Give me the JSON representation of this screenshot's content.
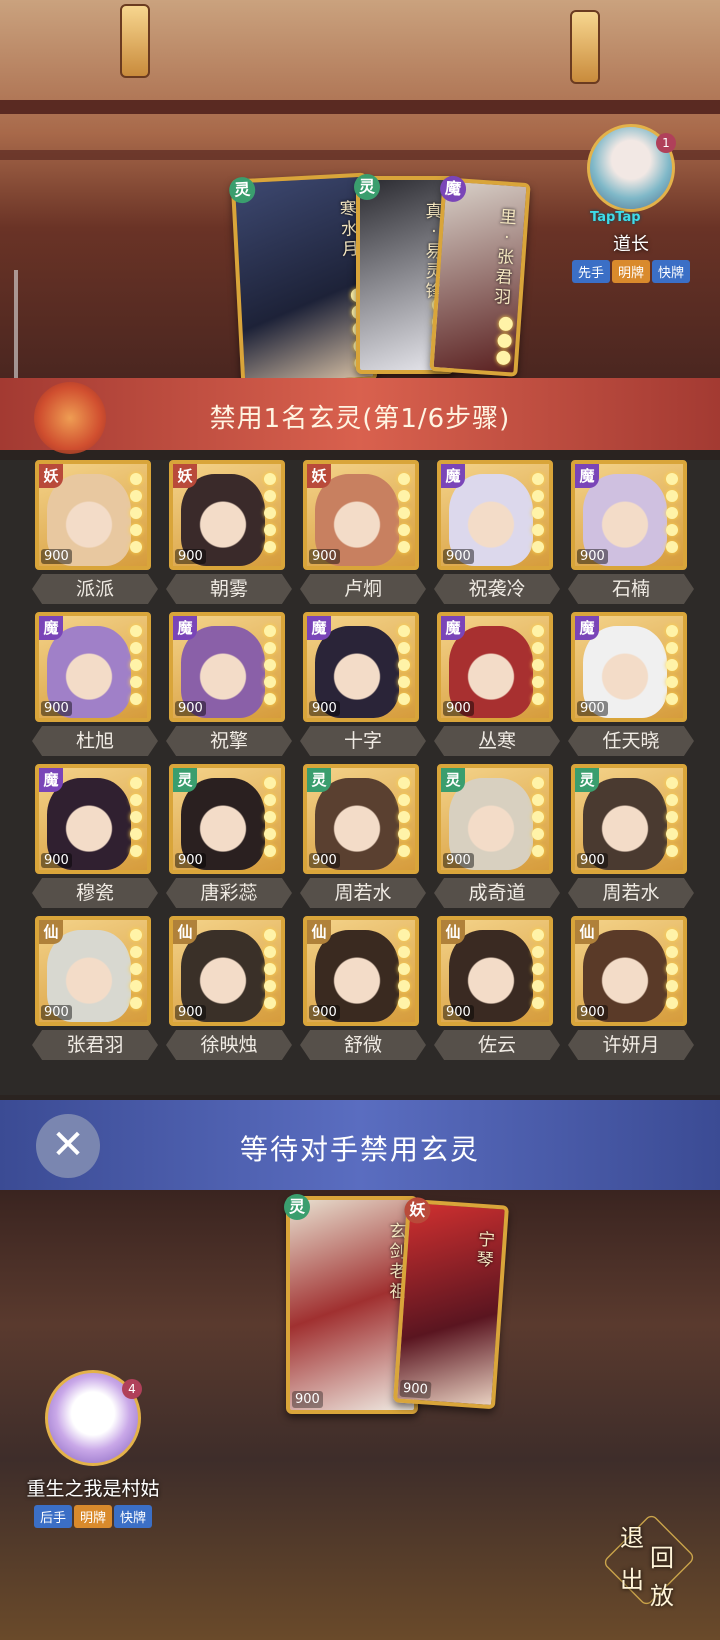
{
  "opponent": {
    "name": "道长",
    "level": "1",
    "platform": "TapTap",
    "tags": [
      "先手",
      "明牌",
      "快牌"
    ],
    "cards": [
      {
        "faction": "灵",
        "name": "寒水月"
      },
      {
        "faction": "灵",
        "name": "真·易灵锋"
      },
      {
        "faction": "魔",
        "name": "里·张君羽"
      }
    ]
  },
  "step_banner": "禁用1名玄灵(第1/6步骤)",
  "roster": [
    {
      "faction": "妖",
      "name": "派派",
      "cost": "900"
    },
    {
      "faction": "妖",
      "name": "朝雾",
      "cost": "900"
    },
    {
      "faction": "妖",
      "name": "卢炯",
      "cost": "900"
    },
    {
      "faction": "魔",
      "name": "祝袭冷",
      "cost": "900"
    },
    {
      "faction": "魔",
      "name": "石楠",
      "cost": "900"
    },
    {
      "faction": "魔",
      "name": "杜旭",
      "cost": "900"
    },
    {
      "faction": "魔",
      "name": "祝擎",
      "cost": "900"
    },
    {
      "faction": "魔",
      "name": "十字",
      "cost": "900"
    },
    {
      "faction": "魔",
      "name": "丛寒",
      "cost": "900"
    },
    {
      "faction": "魔",
      "name": "任天晓",
      "cost": "900"
    },
    {
      "faction": "魔",
      "name": "穆瓷",
      "cost": "900"
    },
    {
      "faction": "灵",
      "name": "唐彩蕊",
      "cost": "900"
    },
    {
      "faction": "灵",
      "name": "周若水",
      "cost": "900"
    },
    {
      "faction": "灵",
      "name": "成奇道",
      "cost": "900"
    },
    {
      "faction": "灵",
      "name": "周若水",
      "cost": "900"
    },
    {
      "faction": "仙",
      "name": "张君羽",
      "cost": "900"
    },
    {
      "faction": "仙",
      "name": "徐映烛",
      "cost": "900"
    },
    {
      "faction": "仙",
      "name": "舒微",
      "cost": "900"
    },
    {
      "faction": "仙",
      "name": "佐云",
      "cost": "900"
    },
    {
      "faction": "仙",
      "name": "许妍月",
      "cost": "900"
    }
  ],
  "wait_text": "等待对手禁用玄灵",
  "close_icon": "✕",
  "player": {
    "name": "重生之我是村姑",
    "level": "4",
    "tags": [
      "后手",
      "明牌",
      "快牌"
    ],
    "cards": [
      {
        "faction": "灵",
        "name": "玄剑老祖",
        "cost": "900"
      },
      {
        "faction": "妖",
        "name": "宁琴",
        "cost": "900"
      }
    ]
  },
  "exit_button": {
    "chars": [
      "退",
      "出",
      "回",
      "放"
    ]
  },
  "colors": {
    "banner": "#c8503f",
    "wait_bar": "#4d5fb0",
    "gold_frame": "#d9a53a"
  }
}
